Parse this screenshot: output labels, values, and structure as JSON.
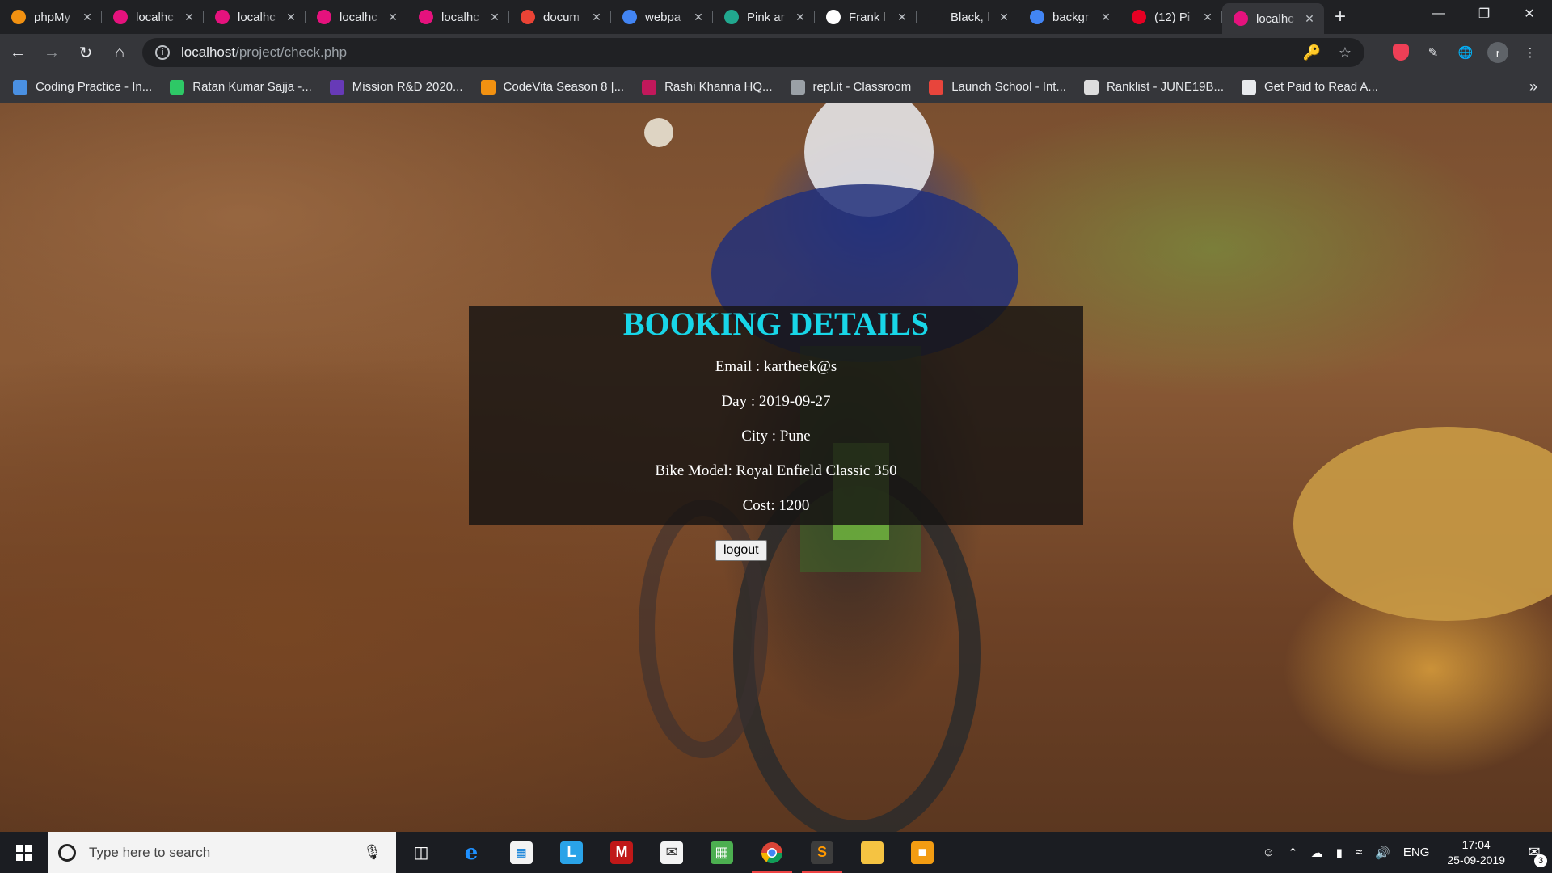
{
  "browser": {
    "tabs": [
      {
        "title": "phpMy",
        "icon": "phpmyadmin-icon",
        "color": "#f29111"
      },
      {
        "title": "localhc",
        "icon": "localhost-icon",
        "color": "#e5127d"
      },
      {
        "title": "localhc",
        "icon": "localhost-icon",
        "color": "#e5127d"
      },
      {
        "title": "localhc",
        "icon": "localhost-icon",
        "color": "#e5127d"
      },
      {
        "title": "localhc",
        "icon": "localhost-icon",
        "color": "#e5127d"
      },
      {
        "title": "docum",
        "icon": "gmail-icon",
        "color": "#ea4335"
      },
      {
        "title": "webpa",
        "icon": "google-icon",
        "color": "#4285f4"
      },
      {
        "title": "Pink ar",
        "icon": "pink-site-icon",
        "color": "#21a88f"
      },
      {
        "title": "Frank l",
        "icon": "frank-site-icon",
        "color": "#ffffff"
      },
      {
        "title": "Black, l",
        "icon": "blank-icon",
        "color": "#202124"
      },
      {
        "title": "backgr",
        "icon": "google-icon",
        "color": "#4285f4"
      },
      {
        "title": "(12) Pi",
        "icon": "pinterest-icon",
        "color": "#e60023"
      },
      {
        "title": "localhc",
        "icon": "localhost-icon",
        "color": "#e5127d",
        "active": true
      }
    ],
    "url_host": "localhost",
    "url_path": "/project/check.php"
  },
  "bookmarks": [
    {
      "label": "Coding Practice - In...",
      "icon": "interviewbit-icon",
      "color": "#4a90e2"
    },
    {
      "label": "Ratan Kumar Sajja -...",
      "icon": "hackerrank-icon",
      "color": "#2ec866"
    },
    {
      "label": "Mission R&D 2020...",
      "icon": "forms-icon",
      "color": "#673ab7"
    },
    {
      "label": "CodeVita Season 8 |...",
      "icon": "codevita-icon",
      "color": "#f29111"
    },
    {
      "label": "Rashi Khanna HQ...",
      "icon": "rashi-icon",
      "color": "#c2185b"
    },
    {
      "label": "repl.it - Classroom",
      "icon": "replit-icon",
      "color": "#9aa0a6"
    },
    {
      "label": "Launch School - Int...",
      "icon": "launchschool-icon",
      "color": "#e8453c"
    },
    {
      "label": "Ranklist - JUNE19B...",
      "icon": "codechef-icon",
      "color": "#dddddd"
    },
    {
      "label": "Get Paid to Read A...",
      "icon": "globe-icon",
      "color": "#e8eaed"
    }
  ],
  "booking": {
    "title": "BOOKING DETAILS",
    "email": "Email : kartheek@s",
    "day": "Day : 2019-09-27",
    "city": "City : Pune",
    "bike_model": "Bike Model: Royal Enfield Classic 350",
    "cost": "Cost: 1200",
    "logout_label": "logout",
    "title_color": "#18d6e8"
  },
  "taskbar": {
    "search_placeholder": "Type here to search",
    "language": "ENG",
    "time": "17:04",
    "date": "25-09-2019",
    "notification_count": "3"
  }
}
